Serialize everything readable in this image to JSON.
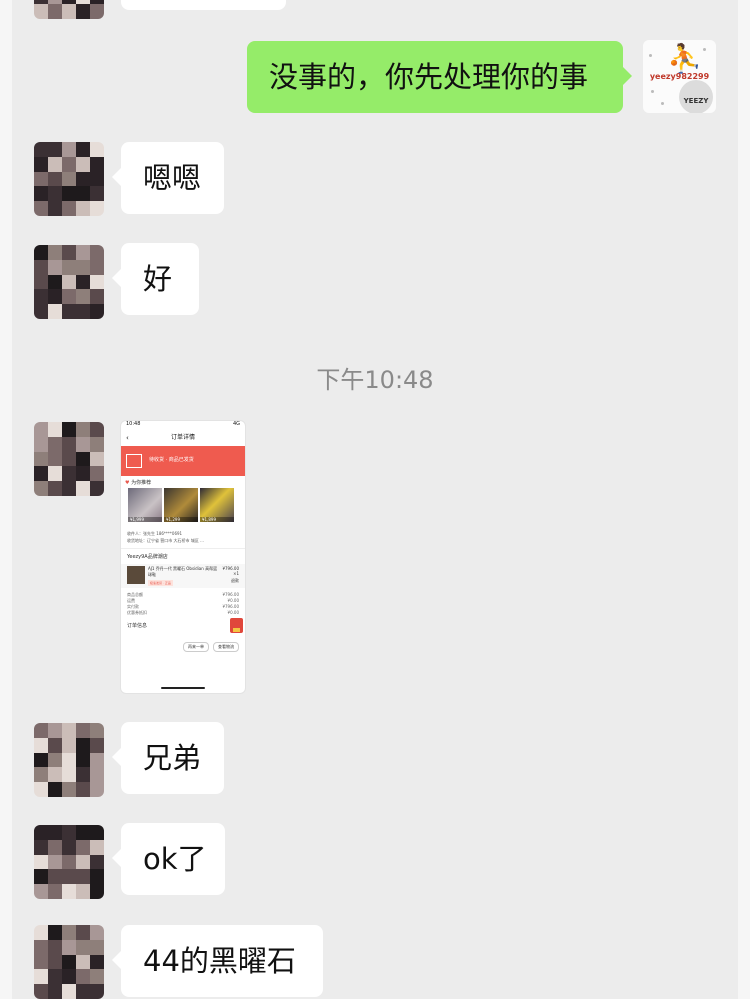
{
  "chat": {
    "self_message": "没事的，你先处理你的事",
    "self_avatar": {
      "icon": "jumpman-logo-icon",
      "handle": "yeezy982299",
      "ball_text": "YEEZY"
    },
    "messages": [
      {
        "text": "嗯嗯"
      },
      {
        "text": "好"
      },
      {
        "text": "兄弟"
      },
      {
        "text": "ok了"
      },
      {
        "text": "44的黑曜石"
      }
    ],
    "timestamp": "下午10:48"
  },
  "screenshot": {
    "status_time": "10:48",
    "status_net": "4G",
    "nav_title": "订单详情",
    "banner_text": "待收货 · 商品已发货",
    "recommend_label": "为你推荐",
    "thumb_prices": [
      "¥1,999",
      "¥1,299",
      "¥1,899"
    ],
    "address_line1": "收件人：张先生  186****0691",
    "address_line2": "收货地址：辽宁省 营口市 大石桥市 城区 ...",
    "shop_name": "Yeezy9A品牌潮店",
    "item_name": "AJ1 乔丹一代 黑曜石 Obsidian 高帮篮球鞋",
    "item_price": "¥796.00",
    "item_qty": "×1",
    "item_tag": "极速发货 · 正品",
    "action_small": "退款",
    "rows": [
      {
        "label": "商品总额",
        "value": "¥796.00"
      },
      {
        "label": "运费",
        "value": "¥0.00"
      },
      {
        "label": "实付款",
        "value": "¥796.00"
      },
      {
        "label": "优惠券抵扣",
        "value": "¥0.00"
      }
    ],
    "order_info": "订单信息",
    "btn_more": "再来一单",
    "btn_confirm": "查看物流"
  }
}
